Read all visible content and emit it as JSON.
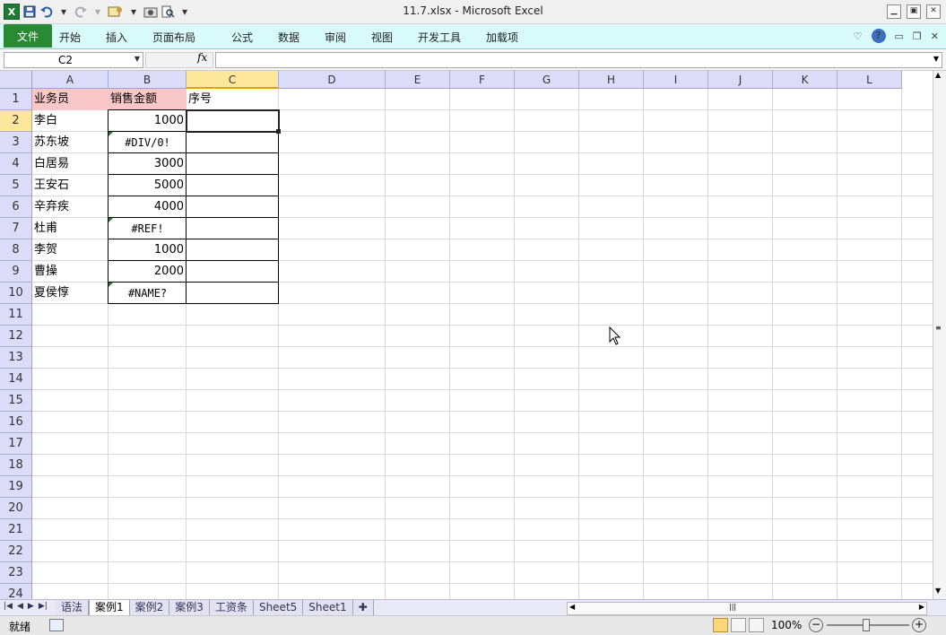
{
  "window": {
    "title": "11.7.xlsx - Microsoft Excel"
  },
  "qat": {
    "logo": "X",
    "save_icon": "save-icon",
    "undo_icon": "undo-icon",
    "redo_icon": "redo-icon"
  },
  "ribbon": {
    "file_tab": "文件",
    "tabs": [
      "开始",
      "插入",
      "页面布局",
      "公式",
      "数据",
      "审阅",
      "视图",
      "开发工具",
      "加载项"
    ]
  },
  "formula": {
    "name_box": "C2",
    "fx": "fx",
    "value": ""
  },
  "columns": [
    "A",
    "B",
    "C",
    "D",
    "E",
    "F",
    "G",
    "H",
    "I",
    "J",
    "K",
    "L"
  ],
  "rows": [
    "1",
    "2",
    "3",
    "4",
    "5",
    "6",
    "7",
    "8",
    "9",
    "10",
    "11",
    "12",
    "13",
    "14",
    "15",
    "16",
    "17",
    "18",
    "19",
    "20",
    "21",
    "22",
    "23",
    "24"
  ],
  "data": {
    "header": {
      "a": "业务员",
      "b": "销售金额",
      "c": "序号"
    },
    "records": [
      {
        "name": "李白",
        "amount": "1000",
        "error": false
      },
      {
        "name": "苏东坡",
        "amount": "#DIV/0!",
        "error": true
      },
      {
        "name": "白居易",
        "amount": "3000",
        "error": false
      },
      {
        "name": "王安石",
        "amount": "5000",
        "error": false
      },
      {
        "name": "辛弃疾",
        "amount": "4000",
        "error": false
      },
      {
        "name": "杜甫",
        "amount": "#REF!",
        "error": true
      },
      {
        "name": "李贺",
        "amount": "1000",
        "error": false
      },
      {
        "name": "曹操",
        "amount": "2000",
        "error": false
      },
      {
        "name": "夏侯惇",
        "amount": "#NAME?",
        "error": true
      }
    ]
  },
  "sheets": [
    "语法",
    "案例1",
    "案例2",
    "案例3",
    "工资条",
    "Sheet5",
    "Sheet1"
  ],
  "active_sheet": "案例1",
  "status": {
    "ready": "就绪",
    "zoom": "100%"
  },
  "colors": {
    "header_fill": "#f9c7c7",
    "error_flag": "#1b7a2f",
    "ribbon_bg": "#d9fbfb"
  }
}
